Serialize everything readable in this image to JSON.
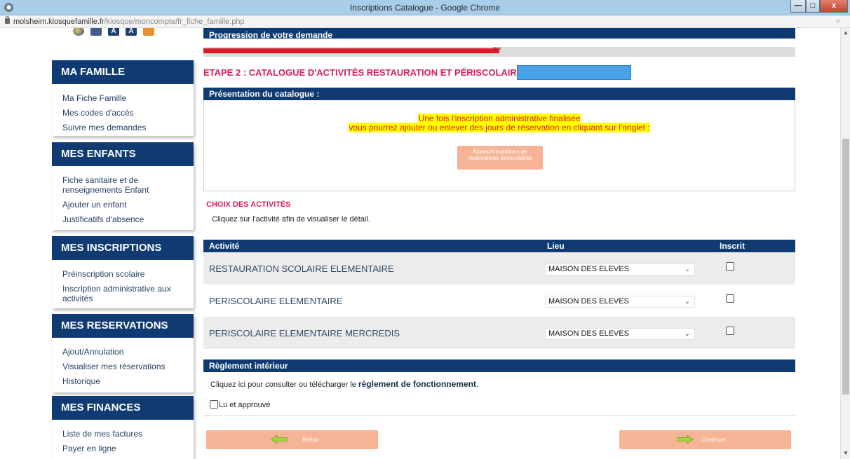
{
  "window": {
    "title": "Inscriptions Catalogue - Google Chrome",
    "url_host": "molsheim.kiosquefamille.fr",
    "url_path": "/kiosque/moncompte/fr_fiche_famille.php",
    "min_label": "—",
    "max_label": "□",
    "close_label": "x"
  },
  "sidebar": {
    "icons": [
      "globe-icon",
      "mail-icon",
      "font-increase-icon",
      "font-decrease-icon",
      "rss-icon"
    ],
    "font_a1": "A",
    "font_a2": "A",
    "famille": {
      "title": "MA FAMILLE",
      "items": [
        "Ma Fiche Famille",
        "Mes codes d'accès",
        "Suivre mes demandes"
      ]
    },
    "enfants": {
      "title": "MES ENFANTS",
      "items": [
        "Fiche sanitaire et de renseignements Enfant",
        "Ajouter un enfant",
        "Justificatifs d'absence"
      ]
    },
    "inscriptions": {
      "title": "MES INSCRIPTIONS",
      "items": [
        "Préinscription scolaire",
        "Inscription administrative aux activités"
      ]
    },
    "reservations": {
      "title": "MES RESERVATIONS",
      "items": [
        "Ajout/Annulation",
        "Visualiser mes réservations",
        "Historique"
      ]
    },
    "finances": {
      "title": "MES FINANCES",
      "items": [
        "Liste de mes factures",
        "Payer en ligne"
      ]
    }
  },
  "main": {
    "progress_title": "Progression de votre demande",
    "progress_value": 0.5,
    "progress_label": "50 %",
    "etape_title": "ETAPE 2 : CATALOGUE D'ACTIVITÉS RESTAURATION ET PÉRISCOLAIRE",
    "presentation_title": "Présentation du catalogue :",
    "info_line1": "Une fois l'inscription administrative finalisée",
    "info_line2": "vous pourrez ajouter ou enlever des jours de réservation en cliquant sur l'onglet :",
    "ajouts_button": "Ajouts/Annulations de réservations périscolaires",
    "choix_title": "CHOIX DES ACTIVITÉS",
    "choix_sub": "Cliquez sur l'activité afin de visualiser le détail.",
    "table": {
      "headers": [
        "Activité",
        "Lieu",
        "Inscrit"
      ],
      "rows": [
        {
          "activite": "RESTAURATION SCOLAIRE ELEMENTAIRE",
          "lieu": "MAISON DES ELEVES",
          "inscrit": false
        },
        {
          "activite": "PERISCOLAIRE ELEMENTAIRE",
          "lieu": "MAISON DES ELEVES",
          "inscrit": false
        },
        {
          "activite": "PERISCOLAIRE ELEMENTAIRE MERCREDIS",
          "lieu": "MAISON DES ELEVES",
          "inscrit": false
        }
      ]
    },
    "reglement_title": "Règlement intérieur",
    "reglement_text": "Cliquez ici pour consulter ou télécharger le",
    "reglement_link": "règlement de fonctionnement",
    "reglement_end": ".",
    "lu_approuve": "Lu et approuvé",
    "retour_button": "Retour",
    "continuer_button": "Continuer"
  },
  "colors": {
    "nav_header": "#0f3a72",
    "accent_pink": "#d81e5b",
    "progress_red": "#e3172a",
    "button_salmon": "#f7b396",
    "highlight_yellow": "#ffff00"
  }
}
